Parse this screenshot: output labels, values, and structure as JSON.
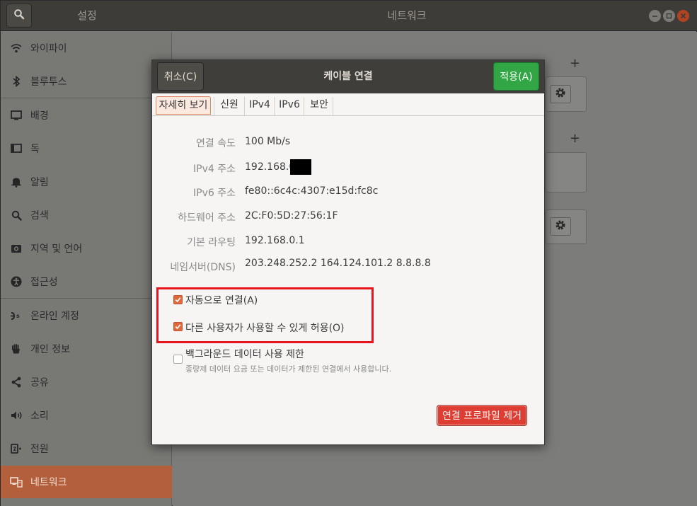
{
  "window": {
    "sidebar_title": "설정",
    "page_title": "네트워크"
  },
  "sidebar": {
    "items": [
      {
        "label": "와이파이",
        "icon": "wifi-icon"
      },
      {
        "label": "블루투스",
        "icon": "bluetooth-icon"
      },
      {
        "label": "배경",
        "icon": "background-icon"
      },
      {
        "label": "독",
        "icon": "dock-icon"
      },
      {
        "label": "알림",
        "icon": "bell-icon"
      },
      {
        "label": "검색",
        "icon": "search-icon"
      },
      {
        "label": "지역 및 언어",
        "icon": "region-icon"
      },
      {
        "label": "접근성",
        "icon": "accessibility-icon"
      },
      {
        "label": "온라인 계정",
        "icon": "online-accounts-icon"
      },
      {
        "label": "개인 정보",
        "icon": "privacy-hand-icon"
      },
      {
        "label": "공유",
        "icon": "share-icon"
      },
      {
        "label": "소리",
        "icon": "speaker-icon"
      },
      {
        "label": "전원",
        "icon": "power-icon"
      },
      {
        "label": "네트워크",
        "icon": "network-icon"
      }
    ],
    "active_index": 13
  },
  "dialog": {
    "title": "케이블 연결",
    "cancel_label": "취소(C)",
    "apply_label": "적용(A)",
    "tabs": [
      "자세히 보기",
      "신원",
      "IPv4",
      "IPv6",
      "보안"
    ],
    "active_tab": 0,
    "details": [
      {
        "label": "연결 속도",
        "value": "100 Mb/s"
      },
      {
        "label": "IPv4 주소",
        "value": "192.168.0"
      },
      {
        "label": "IPv6 주소",
        "value": "fe80::6c4c:4307:e15d:fc8c"
      },
      {
        "label": "하드웨어 주소",
        "value": "2C:F0:5D:27:56:1F"
      },
      {
        "label": "기본 라우팅",
        "value": "192.168.0.1"
      },
      {
        "label": "네임서버(DNS)",
        "value": "203.248.252.2 164.124.101.2 8.8.8.8"
      }
    ],
    "options": {
      "auto_connect": {
        "label": "자동으로 연결(A)",
        "checked": true
      },
      "allow_other_users": {
        "label": "다른 사용자가 사용할 수 있게 허용(O)",
        "checked": true
      },
      "restrict_background": {
        "label": "백그라운드 데이터 사용 제한",
        "hint": "종량제 데이터 요금 또는 데이터가 제한된 연결에서 사용합니다.",
        "checked": false
      }
    },
    "remove_label": "연결 프로파일 제거"
  },
  "colors": {
    "accent": "#e0683c",
    "active_sidebar": "#b35f3b",
    "apply_green": "#32a645",
    "remove_red": "#dd3d32",
    "annotation_red": "#e8141c"
  }
}
